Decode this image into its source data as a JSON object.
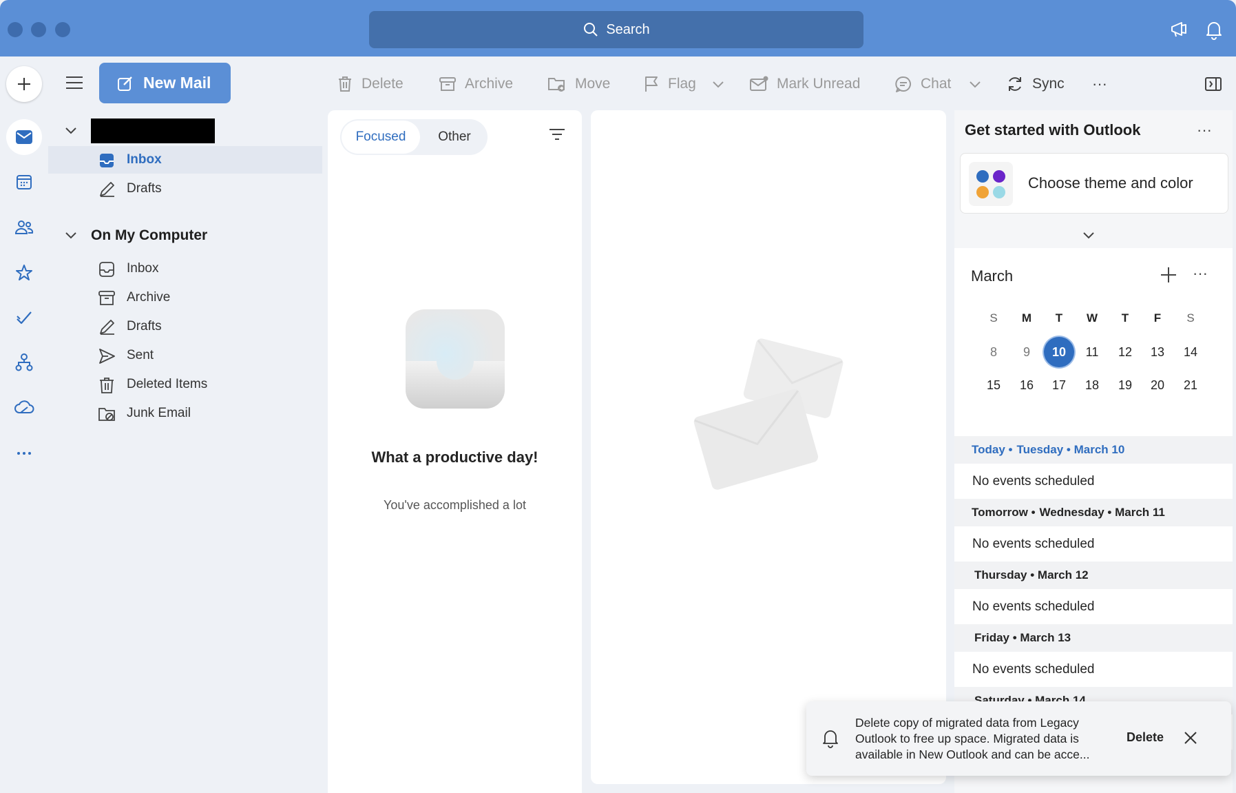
{
  "titlebar": {
    "search_label": "Search"
  },
  "toolbar": {
    "new_mail": "New Mail",
    "delete": "Delete",
    "archive": "Archive",
    "move": "Move",
    "flag": "Flag",
    "mark_unread": "Mark Unread",
    "chat": "Chat",
    "sync": "Sync",
    "more": "···"
  },
  "folders": {
    "account_items": [
      {
        "label": "Inbox",
        "icon": "inbox-icon",
        "selected": true
      },
      {
        "label": "Drafts",
        "icon": "drafts-icon"
      }
    ],
    "section_title": "On My Computer",
    "local_items": [
      {
        "label": "Inbox",
        "icon": "inbox-icon"
      },
      {
        "label": "Archive",
        "icon": "archive-icon"
      },
      {
        "label": "Drafts",
        "icon": "drafts-icon"
      },
      {
        "label": "Sent",
        "icon": "sent-icon"
      },
      {
        "label": "Deleted Items",
        "icon": "trash-icon"
      },
      {
        "label": "Junk Email",
        "icon": "junk-icon"
      }
    ]
  },
  "message_list": {
    "tabs": {
      "focused": "Focused",
      "other": "Other"
    },
    "empty_title": "What a productive day!",
    "empty_subtitle": "You've accomplished a lot"
  },
  "right_pane": {
    "getting_started_title": "Get started with Outlook",
    "more": "···",
    "theme_card_label": "Choose theme and color",
    "theme_colors": [
      "#2f6dbf",
      "#6a24c9",
      "#f0a336",
      "#9ad9e6"
    ],
    "calendar": {
      "month": "March",
      "more": "···",
      "weekdays": [
        "S",
        "M",
        "T",
        "W",
        "T",
        "F",
        "S"
      ],
      "week1": [
        "8",
        "9",
        "10",
        "11",
        "12",
        "13",
        "14"
      ],
      "week2": [
        "15",
        "16",
        "17",
        "18",
        "19",
        "20",
        "21"
      ],
      "today": "10"
    },
    "agenda": {
      "today_label": "Today •",
      "today_date": "Tuesday • March 10",
      "tomorrow_label": "Tomorrow •",
      "tomorrow_date": "Wednesday • March 11",
      "thu": "Thursday • March 12",
      "fri": "Friday • March 13",
      "sat": "Saturday • March 14",
      "no_events": "No events scheduled"
    }
  },
  "toast": {
    "message": "Delete copy of migrated data from Legacy Outlook to free up space. Migrated data is available in New Outlook and can be acce...",
    "action": "Delete"
  },
  "colors": {
    "accent": "#2f6dbf",
    "titlebar": "#5b8fd6"
  }
}
